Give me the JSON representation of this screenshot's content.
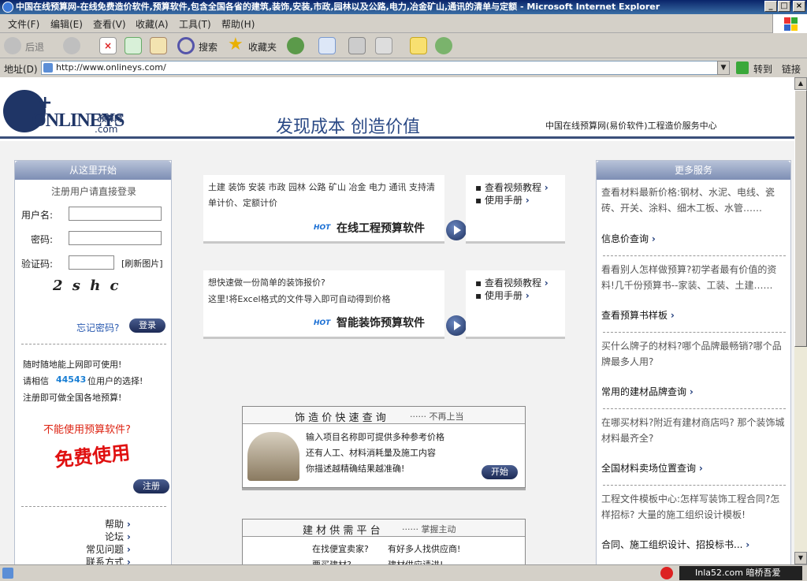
{
  "window": {
    "title": "中国在线预算网-在线免费造价软件,预算软件,包含全国各省的建筑,装饰,安装,市政,园林以及公路,电力,冶金矿山,通讯的清单与定额 - Microsoft Internet Explorer"
  },
  "menu": [
    "文件(F)",
    "编辑(E)",
    "查看(V)",
    "收藏(A)",
    "工具(T)",
    "帮助(H)"
  ],
  "toolbar": {
    "back": "后退",
    "search": "搜索",
    "favorites": "收藏夹"
  },
  "address": {
    "label": "地址(D)",
    "url": "http://www.onlineys.com/",
    "go": "转到",
    "links": "链接"
  },
  "header": {
    "logo_main": "ONLINEYS",
    "logo_domain": ".com",
    "logo_tag": "预算网",
    "slogan": "发现成本 创造价值",
    "center": "中国在线预算网(易价软件)工程造价服务中心"
  },
  "left": {
    "head": "从这里开始",
    "tip": "注册用户请直接登录",
    "user_label": "用户名:",
    "pass_label": "密码:",
    "captcha_label": "验证码:",
    "refresh": "[刷新图片]",
    "captcha": "2 s h c",
    "forgot": "忘记密码?",
    "login": "登录",
    "line1": "随时随地能上网即可使用!",
    "line2a": "请相信",
    "count": "44543",
    "line2b": "位用户的选择!",
    "line3": "注册即可做全国各地预算!",
    "cant_use": "不能使用预算软件?",
    "free": "免费使用",
    "register": "注册",
    "links": [
      "帮助",
      "论坛",
      "常见问题",
      "联系方式"
    ]
  },
  "promo1": {
    "text": "土建 装饰 安装 市政 园林 公路 矿山 冶金 电力 通讯 支持清单计价、定额计价",
    "hot": "HOT",
    "title": "在线工程预算软件",
    "links": [
      "查看视频教程",
      "使用手册"
    ]
  },
  "promo2": {
    "text1": "想快速做一份简单的装饰报价?",
    "text2": "这里!将Excel格式的文件导入即可自动得到价格",
    "hot": "HOT",
    "title": "智能装饰预算软件",
    "links": [
      "查看视频教程",
      "使用手册"
    ]
  },
  "query": {
    "title": "饰 造 价 快 速 查 询",
    "sub": "······ 不再上当",
    "lines": [
      "输入项目名称即可提供多种参考价格",
      "还有人工、材料消耗量及施工内容",
      "你描述越精确结果越准确!"
    ],
    "button": "开始"
  },
  "supply": {
    "title": "建 材 供 需 平 台",
    "sub": "······ 掌握主动",
    "col1": [
      "在找便宜卖家?",
      "要买建材?"
    ],
    "col2": [
      "有好多人找供应商!",
      "建材供应请进!"
    ]
  },
  "right": {
    "head": "更多服务",
    "items": [
      {
        "text": "查看材料最新价格:钢材、水泥、电线、瓷砖、开关、涂料、细木工板、水管……",
        "link": "信息价查询"
      },
      {
        "text": "看看别人怎样做预算?初学者最有价值的资料!几千份预算书--家装、工装、土建……",
        "link": "查看预算书样板"
      },
      {
        "text": "买什么牌子的材料?哪个品牌最畅销?哪个品牌最多人用?",
        "link": "常用的建材品牌查询"
      },
      {
        "text": "在哪买材料?附近有建材商店吗? 那个装饰城材料最齐全?",
        "link": "全国材料卖场位置查询"
      },
      {
        "text": "工程文件模板中心:怎样写装饰工程合同?怎样招标? 大量的施工组织设计模板!",
        "link": "合同、施工组织设计、招投标书..."
      }
    ]
  },
  "status": {
    "watermark": "Inla52.com 暗桥吾爱"
  }
}
